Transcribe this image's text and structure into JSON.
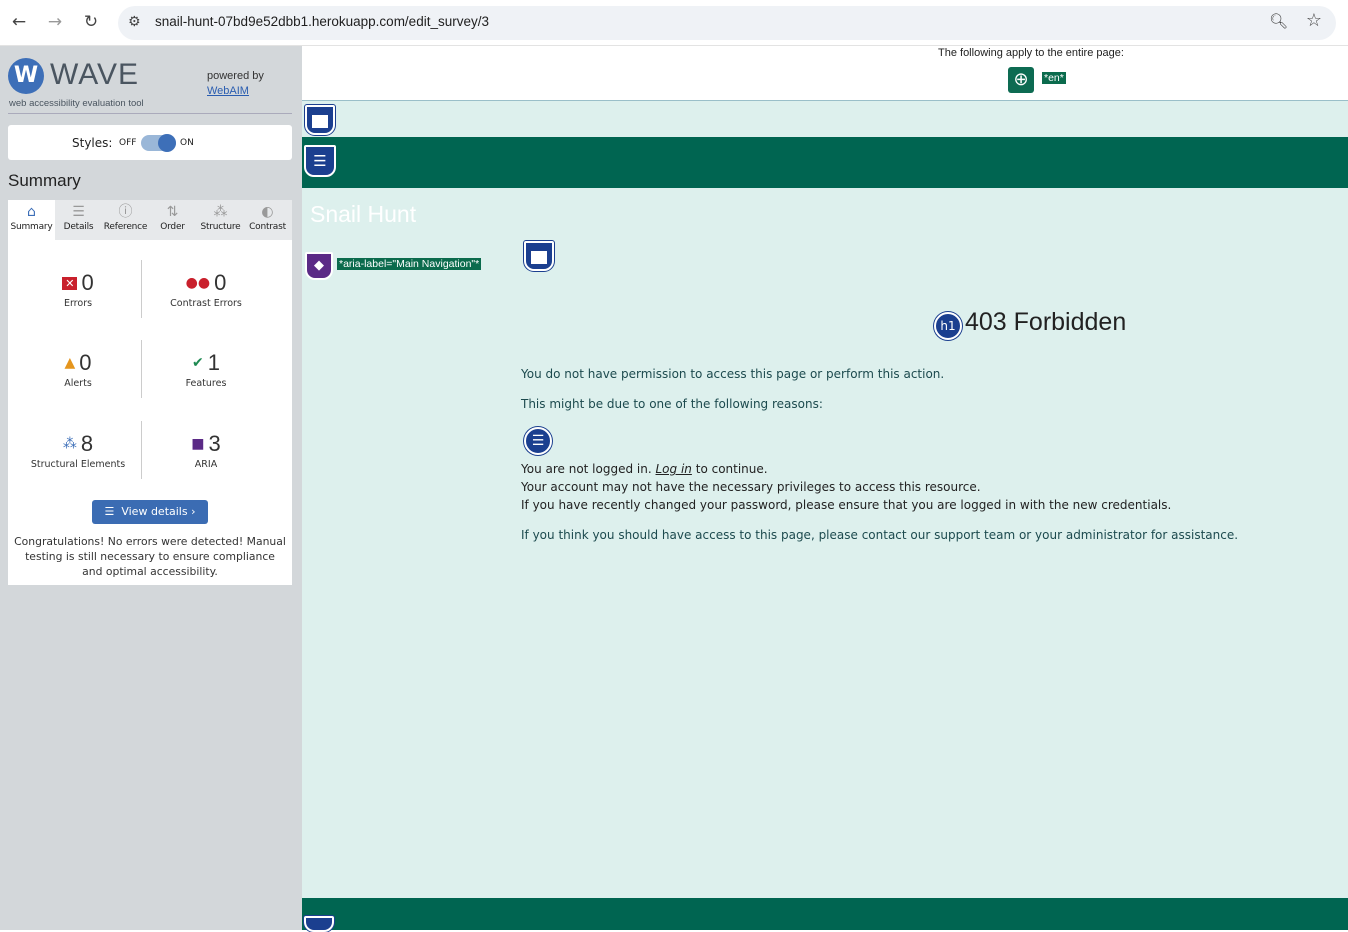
{
  "browser": {
    "url": "snail-hunt-07bd9e52dbb1.herokuapp.com/edit_survey/3",
    "icons": [
      "back-arrow-icon",
      "forward-arrow-icon",
      "reload-icon",
      "site-info-icon",
      "zoom-icon",
      "bookmark-star-icon"
    ]
  },
  "wave": {
    "logo_name": "WAVE",
    "logo_letter": "W",
    "tagline": "web accessibility evaluation tool",
    "powered_by": "powered by",
    "webaim_link": "WebAIM",
    "styles_label": "Styles:",
    "styles_off": "OFF",
    "styles_on": "ON",
    "summary_title": "Summary",
    "tabs": [
      {
        "label": "Summary",
        "icon": "home-icon"
      },
      {
        "label": "Details",
        "icon": "list-icon"
      },
      {
        "label": "Reference",
        "icon": "info-icon"
      },
      {
        "label": "Order",
        "icon": "order-icon"
      },
      {
        "label": "Structure",
        "icon": "structure-icon"
      },
      {
        "label": "Contrast",
        "icon": "contrast-icon"
      }
    ],
    "stats": {
      "errors": {
        "value": "0",
        "label": "Errors"
      },
      "contrast_errors": {
        "value": "0",
        "label": "Contrast Errors"
      },
      "alerts": {
        "value": "0",
        "label": "Alerts"
      },
      "features": {
        "value": "1",
        "label": "Features"
      },
      "structural": {
        "value": "8",
        "label": "Structural Elements"
      },
      "aria": {
        "value": "3",
        "label": "ARIA"
      }
    },
    "view_details": "View details ›",
    "congrats": "Congratulations! No errors were detected! Manual testing is still necessary to ensure compliance and optimal accessibility."
  },
  "page": {
    "applies_text": "The following apply to the entire page:",
    "lang_badge": "*en*",
    "site_title": "Snail Hunt",
    "aria_badge": "*aria-label=\"Main Navigation\"*",
    "h1_label": "h1",
    "heading": "403 Forbidden",
    "p1": "You do not have permission to access this page or perform this action.",
    "p2": "This might be due to one of the following reasons:",
    "li1_before": "You are not logged in.",
    "li1_link": "Log in",
    "li1_after": "to continue.",
    "li2": "Your account may not have the necessary privileges to access this resource.",
    "li3": "If you have recently changed your password, please ensure that you are logged in with the new credentials.",
    "p3": "If you think you should have access to this page, please contact our support team or your administrator for assistance."
  },
  "colors": {
    "wave_accent": "#3d6fb8",
    "page_bg": "#ddf0ed",
    "green_band": "#006551",
    "aria_purple": "#5b2a86"
  }
}
